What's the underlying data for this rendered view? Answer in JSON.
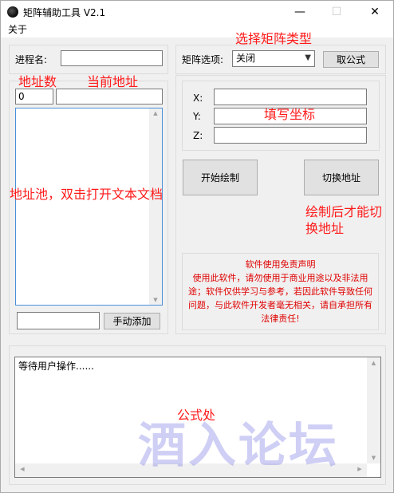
{
  "window": {
    "title": "矩阵辅助工具 V2.1",
    "controls": {
      "minimize": "—",
      "maximize": "☐",
      "close": "✕"
    }
  },
  "menu": {
    "about": "关于"
  },
  "process": {
    "label": "进程名:",
    "value": ""
  },
  "address": {
    "count_value": "0",
    "current_value": "",
    "pool_items": [],
    "add_input_value": "",
    "add_button": "手动添加"
  },
  "matrix": {
    "option_label": "矩阵选项:",
    "option_selected": "关闭",
    "formula_button": "取公式",
    "x_label": "X:",
    "y_label": "Y:",
    "z_label": "Z:",
    "x_value": "",
    "y_value": "",
    "z_value": ""
  },
  "actions": {
    "start_draw": "开始绘制",
    "switch_address": "切换地址"
  },
  "disclaimer": {
    "title": "软件使用免责声明",
    "body": "使用此软件，请勿使用于商业用途以及非法用途；软件仅供学习与参考，若因此软件导致任何问题，与此软件开发者毫无相关，请自承担所有法律责任!"
  },
  "log": {
    "text": "等待用户操作......"
  },
  "annotations": {
    "select_matrix_type": "选择矩阵类型",
    "address_count": "地址数",
    "current_address": "当前地址",
    "fill_coordinates": "填写坐标",
    "address_pool": "地址池，双击打开文本文档",
    "switch_after_draw_line1": "绘制后才能切",
    "switch_after_draw_line2": "换地址",
    "formula_area": "公式处"
  },
  "watermark": "酒入论坛",
  "colors": {
    "annotation": "#ff1a1a",
    "disclaimer_text": "#e00000",
    "watermark": "#6969e1",
    "window_bg": "#f0f0f0"
  }
}
